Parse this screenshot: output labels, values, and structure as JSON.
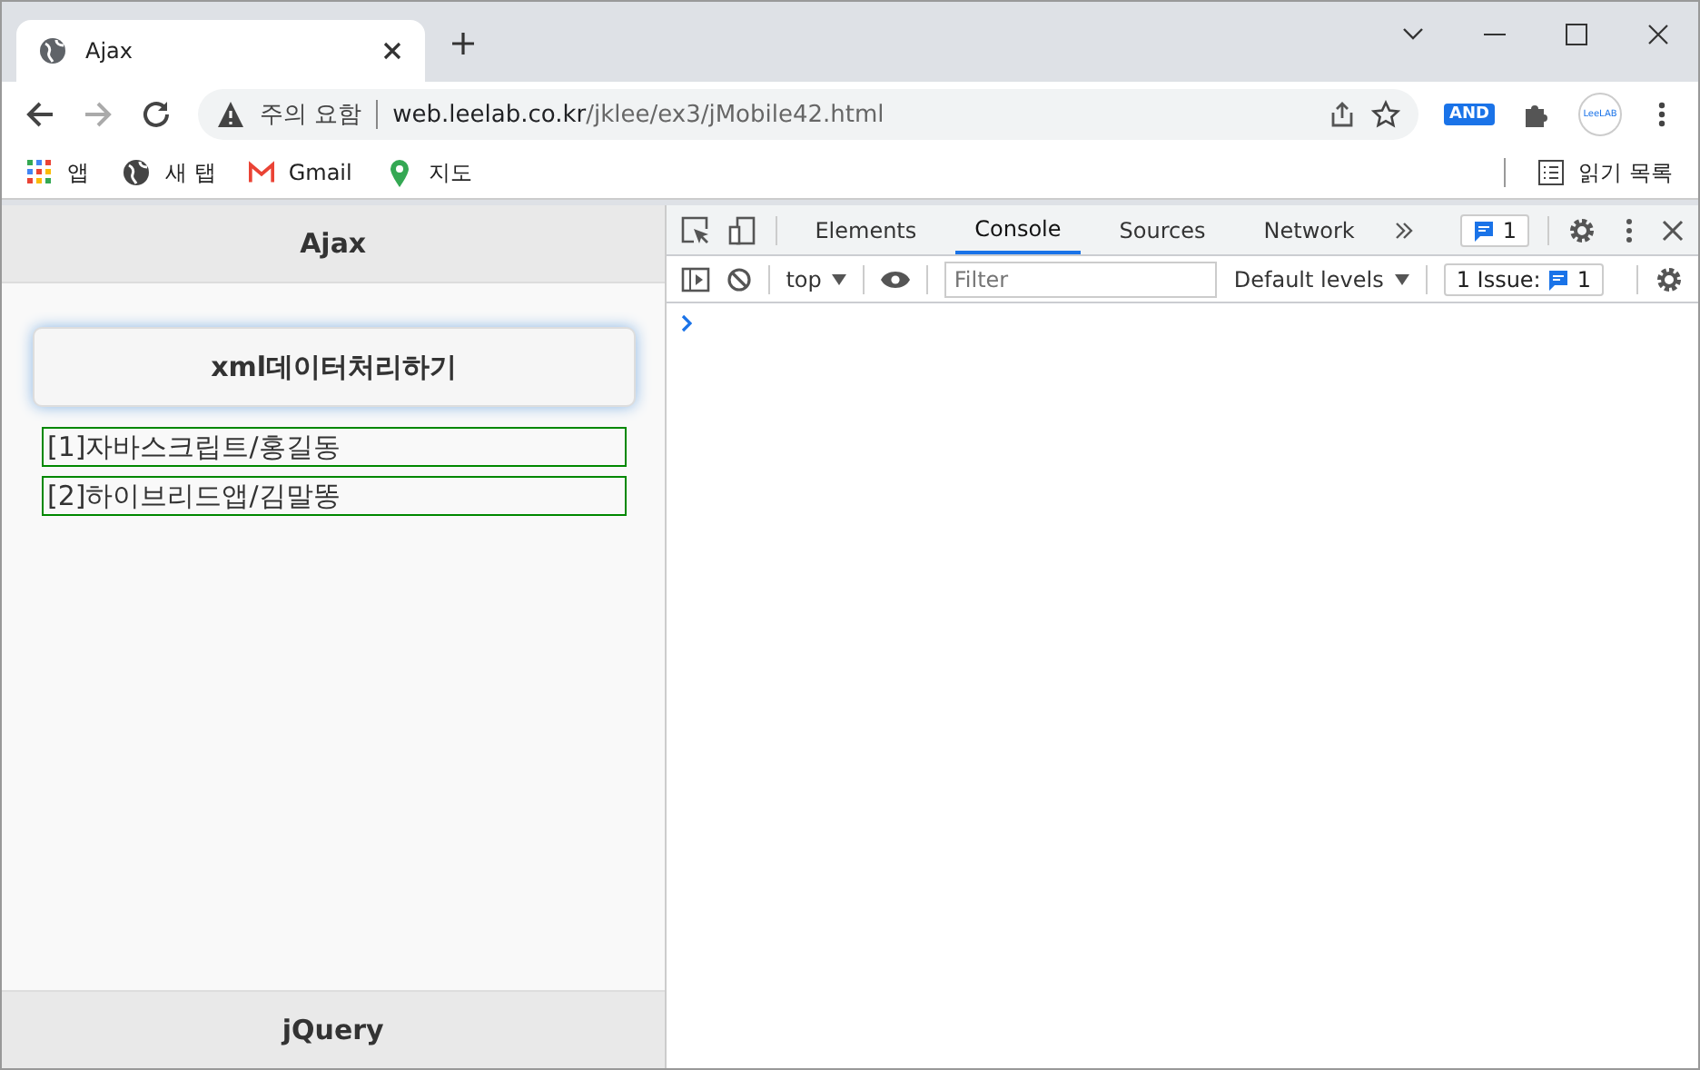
{
  "browser_tab": {
    "title": "Ajax",
    "selected": true
  },
  "address_bar": {
    "security": "주의 요함",
    "host": "web.leelab.co.kr",
    "path": "/jklee/ex3/jMobile42.html"
  },
  "extensions": {
    "badge": "AND",
    "profile": "LeeLAB"
  },
  "bookmarks": [
    {
      "kind": "apps",
      "label": "앱"
    },
    {
      "kind": "globe",
      "label": "새 탭"
    },
    {
      "kind": "mail",
      "label": "Gmail"
    },
    {
      "kind": "pin",
      "label": "지도"
    }
  ],
  "reading_list": "읽기 목록",
  "page": {
    "header": "Ajax",
    "button": "xml데이터처리하기",
    "items": [
      "[1]자바스크립트/홍길동",
      "[2]하이브리드앱/김말똥"
    ],
    "footer": "jQuery"
  },
  "devtools": {
    "tabs": [
      {
        "label": "Elements",
        "selected": false
      },
      {
        "label": "Console",
        "selected": true
      },
      {
        "label": "Sources",
        "selected": false
      },
      {
        "label": "Network",
        "selected": false
      }
    ],
    "messages_count": "1",
    "context": "top",
    "filter_placeholder": "Filter",
    "levels": "Default levels",
    "issues_label": "1 Issue:",
    "issues_count": "1"
  }
}
